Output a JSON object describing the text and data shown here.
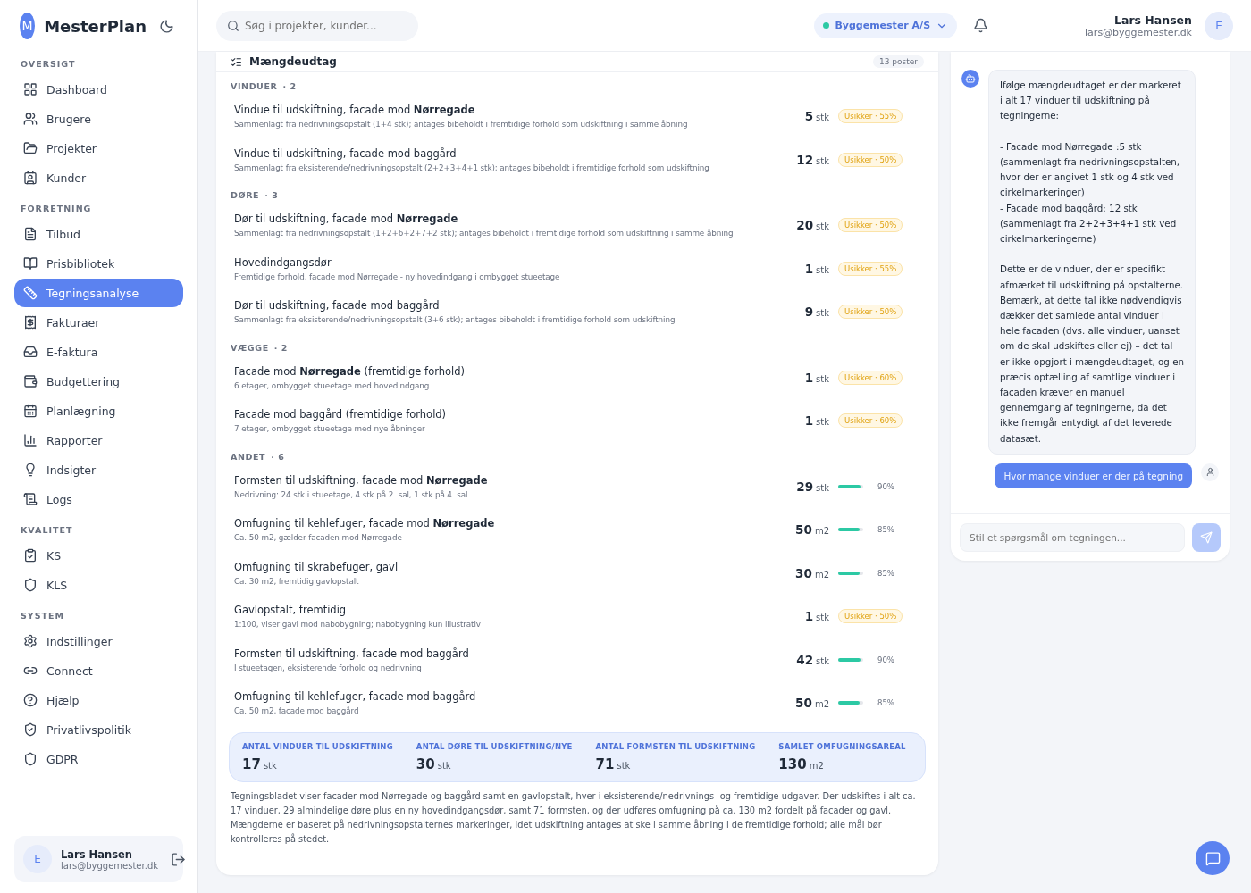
{
  "brand": {
    "logo": "M",
    "name": "MesterPlan"
  },
  "sidebar": {
    "sections": [
      {
        "title": "OVERSIGT",
        "items": [
          {
            "label": "Dashboard",
            "selected": false
          },
          {
            "label": "Brugere",
            "selected": false
          },
          {
            "label": "Projekter",
            "selected": false
          },
          {
            "label": "Kunder",
            "selected": false
          }
        ]
      },
      {
        "title": "FORRETNING",
        "items": [
          {
            "label": "Tilbud",
            "selected": false
          },
          {
            "label": "Prisbibliotek",
            "selected": false
          },
          {
            "label": "Tegningsanalyse",
            "selected": true
          },
          {
            "label": "Fakturaer",
            "selected": false
          },
          {
            "label": "E-faktura",
            "selected": false
          },
          {
            "label": "Budgettering",
            "selected": false
          },
          {
            "label": "Planlægning",
            "selected": false
          },
          {
            "label": "Rapporter",
            "selected": false
          },
          {
            "label": "Indsigter",
            "selected": false
          },
          {
            "label": "Logs",
            "selected": false
          }
        ]
      },
      {
        "title": "KVALITET",
        "items": [
          {
            "label": "KS",
            "selected": false
          },
          {
            "label": "KLS",
            "selected": false
          }
        ]
      },
      {
        "title": "SYSTEM",
        "items": [
          {
            "label": "Indstillinger",
            "selected": false
          },
          {
            "label": "Connect",
            "selected": false
          },
          {
            "label": "Hjælp",
            "selected": false
          },
          {
            "label": "Privatlivspolitik",
            "selected": false
          },
          {
            "label": "GDPR",
            "selected": false
          }
        ]
      }
    ],
    "user": {
      "avatar": "E",
      "name": "Lars Hansen",
      "email": "lars@byggemester.dk"
    }
  },
  "topbar": {
    "search": {
      "placeholder": "Søg i projekter, kunder..."
    },
    "company": "Byggemester A/S",
    "user": {
      "name": "Lars Hansen",
      "email": "lars@byggemester.dk",
      "avatar": "E"
    }
  },
  "card": {
    "title": "Mængdeudtag",
    "count": "13 poster",
    "groups": [
      {
        "name": "VINDUER",
        "count": "· 2",
        "rows": [
          {
            "title": "Vindue til udskiftning, facade mod **Nørregade**",
            "note": "Sammenlagt fra nedrivningsopstalt (1+4 stk); antages bibeholdt i fremtidige forhold som udskiftning i samme åbning",
            "qty": "5",
            "unit": "stk",
            "kind": "uncertain",
            "badge": "Usikker · 55%"
          },
          {
            "title": "Vindue til udskiftning, facade mod baggård",
            "note": "Sammenlagt fra eksisterende/nedrivningsopstalt (2+2+3+4+1 stk); antages bibeholdt i fremtidige forhold som udskiftning",
            "qty": "12",
            "unit": "stk",
            "kind": "uncertain",
            "badge": "Usikker · 50%"
          }
        ]
      },
      {
        "name": "DØRE",
        "count": "· 3",
        "rows": [
          {
            "title": "Dør til udskiftning, facade mod **Nørregade**",
            "note": "Sammenlagt fra nedrivningsopstalt (1+2+6+2+7+2 stk); antages bibeholdt i fremtidige forhold som udskiftning i samme åbning",
            "qty": "20",
            "unit": "stk",
            "kind": "uncertain",
            "badge": "Usikker · 50%"
          },
          {
            "title": "Hovedindgangsdør",
            "note": "Fremtidige forhold, facade mod Nørregade - ny hovedindgang i ombygget stueetage",
            "qty": "1",
            "unit": "stk",
            "kind": "uncertain",
            "badge": "Usikker · 55%"
          },
          {
            "title": "Dør til udskiftning, facade mod baggård",
            "note": "Sammenlagt fra eksisterende/nedrivningsopstalt (3+6 stk); antages bibeholdt i fremtidige forhold som udskiftning",
            "qty": "9",
            "unit": "stk",
            "kind": "uncertain",
            "badge": "Usikker · 50%"
          }
        ]
      },
      {
        "name": "VÆGGE",
        "count": "· 2",
        "rows": [
          {
            "title": "Facade mod **Nørregade** (fremtidige forhold)",
            "note": "6 etager, ombygget stueetage med hovedindgang",
            "qty": "1",
            "unit": "stk",
            "kind": "uncertain",
            "badge": "Usikker · 60%"
          },
          {
            "title": "Facade mod baggård (fremtidige forhold)",
            "note": "7 etager, ombygget stueetage med nye åbninger",
            "qty": "1",
            "unit": "stk",
            "kind": "uncertain",
            "badge": "Usikker · 60%"
          }
        ]
      },
      {
        "name": "ANDET",
        "count": "· 6",
        "rows": [
          {
            "title": "Formsten til udskiftning, facade mod **Nørregade**",
            "note": "Nedrivning: 24 stk i stueetage, 4 stk på 2. sal, 1 stk på 4. sal",
            "qty": "29",
            "unit": "stk",
            "kind": "confidence",
            "level": 0.9,
            "pct": "90%"
          },
          {
            "title": "Omfugning til kehlefuger, facade mod **Nørregade**",
            "note": "Ca. 50 m2, gælder facaden mod Nørregade",
            "qty": "50",
            "unit": "m2",
            "kind": "confidence",
            "level": 0.85,
            "pct": "85%"
          },
          {
            "title": "Omfugning til skrabefuger, gavl",
            "note": "Ca. 30 m2, fremtidig gavlopstalt",
            "qty": "30",
            "unit": "m2",
            "kind": "confidence",
            "level": 0.85,
            "pct": "85%"
          },
          {
            "title": "Gavlopstalt, fremtidig",
            "note": "1:100, viser gavl mod nabobygning; nabobygning kun illustrativ",
            "qty": "1",
            "unit": "stk",
            "kind": "uncertain",
            "badge": "Usikker · 50%"
          },
          {
            "title": "Formsten til udskiftning, facade mod baggård",
            "note": "I stueetagen, eksisterende forhold og nedrivning",
            "qty": "42",
            "unit": "stk",
            "kind": "confidence",
            "level": 0.9,
            "pct": "90%"
          },
          {
            "title": "Omfugning til kehlefuger, facade mod baggård",
            "note": "Ca. 50 m2, facade mod baggård",
            "qty": "50",
            "unit": "m2",
            "kind": "confidence",
            "level": 0.85,
            "pct": "85%"
          }
        ]
      }
    ],
    "summary": [
      {
        "label": "ANTAL VINDUER TIL UDSKIFTNING",
        "value": "17",
        "unit": "stk"
      },
      {
        "label": "ANTAL DØRE TIL UDSKIFTNING/NYE",
        "value": "30",
        "unit": "stk"
      },
      {
        "label": "ANTAL FORMSTEN TIL UDSKIFTNING",
        "value": "71",
        "unit": "stk"
      },
      {
        "label": "SAMLET OMFUGNINGSAREAL",
        "value": "130",
        "unit": "m2"
      }
    ],
    "description": "Tegningsbladet viser facader mod Nørregade og baggård samt en gavlopstalt, hver i eksisterende/nedrivnings- og fremtidige udgaver. Der udskiftes i alt ca. 17 vinduer, 29 almindelige døre plus en ny hovedindgangsdør, samt 71 formsten, og der udføres omfugning på ca. 130 m2 fordelt på facader og gavl. Mængderne er baseret på nedrivningsopstalternes markeringer, idet udskiftning antages at ske i samme åbning i de fremtidige forhold; alle mål bør kontrolleres på stedet."
  },
  "chat": {
    "messages": [
      {
        "kind": "bot",
        "text": "Ifølge mængdeudtaget er der markeret i alt 17 vinduer til udskiftning på tegningerne:\n\n- Facade mod Nørregade :5 stk (sammenlagt fra nedrivningsopstalten, hvor der er angivet 1 stk og 4 stk ved cirkelmarkeringer)\n- Facade mod baggård: 12 stk (sammenlagt fra 2+2+3+4+1 stk ved cirkelmarkeringerne)\n\nDette er de vinduer, der er specifikt afmærket til udskiftning på opstalterne. Bemærk, at dette tal ikke nødvendigvis dækker det samlede antal vinduer i hele facaden (dvs. alle vinduer, uanset om de skal udskiftes eller ej) – det tal er ikke opgjort i mængdeudtaget, og en præcis optælling af samtlige vinduer i facaden kræver en manuel gennemgang af tegningerne, da det ikke fremgår entydigt af det leverede datasæt."
      },
      {
        "kind": "user",
        "text": "Hvor mange vinduer er der på tegning"
      }
    ],
    "input": {
      "placeholder": "Stil et spørgsmål om tegningen..."
    },
    "send_disabled": true
  }
}
